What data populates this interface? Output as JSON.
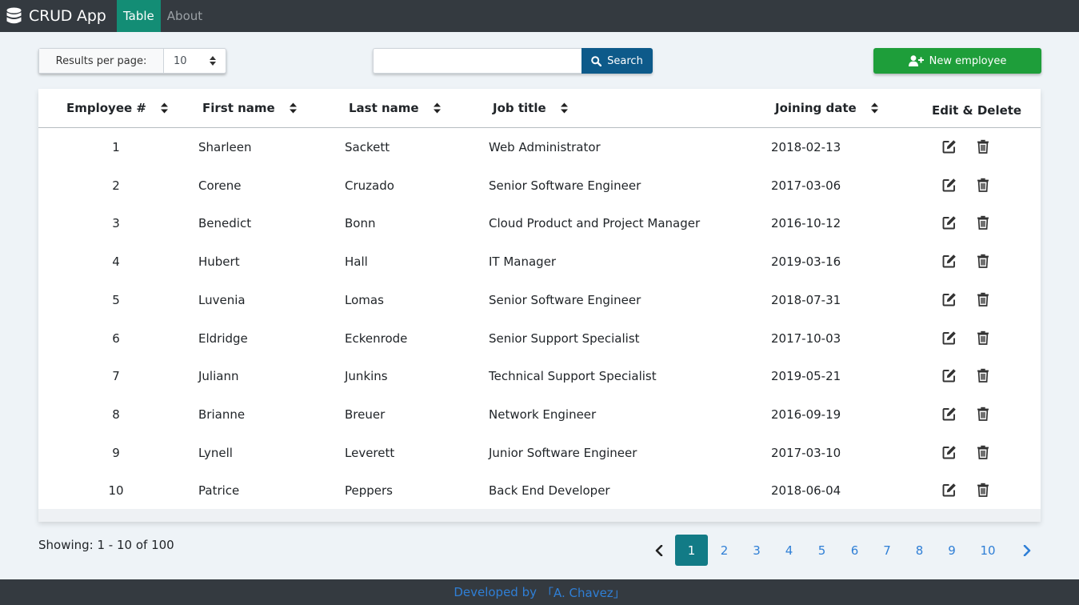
{
  "navbar": {
    "brand": "CRUD App",
    "tabs": [
      {
        "label": "Table",
        "active": true
      },
      {
        "label": "About",
        "active": false
      }
    ]
  },
  "toolbar": {
    "per_page_label": "Results per page:",
    "per_page_value": "10",
    "search_placeholder": "",
    "search_value": "",
    "search_label": "Search",
    "new_employee_label": "New employee"
  },
  "table": {
    "headers": [
      "Employee #",
      "First name",
      "Last name",
      "Job title",
      "Joining date",
      "Edit & Delete"
    ],
    "rows": [
      {
        "id": "1",
        "first": "Sharleen",
        "last": "Sackett",
        "job": "Web Administrator",
        "date": "2018-02-13"
      },
      {
        "id": "2",
        "first": "Corene",
        "last": "Cruzado",
        "job": "Senior Software Engineer",
        "date": "2017-03-06"
      },
      {
        "id": "3",
        "first": "Benedict",
        "last": "Bonn",
        "job": "Cloud Product and Project Manager",
        "date": "2016-10-12"
      },
      {
        "id": "4",
        "first": "Hubert",
        "last": "Hall",
        "job": "IT Manager",
        "date": "2019-03-16"
      },
      {
        "id": "5",
        "first": "Luvenia",
        "last": "Lomas",
        "job": "Senior Software Engineer",
        "date": "2018-07-31"
      },
      {
        "id": "6",
        "first": "Eldridge",
        "last": "Eckenrode",
        "job": "Senior Support Specialist",
        "date": "2017-10-03"
      },
      {
        "id": "7",
        "first": "Juliann",
        "last": "Junkins",
        "job": "Technical Support Specialist",
        "date": "2019-05-21"
      },
      {
        "id": "8",
        "first": "Brianne",
        "last": "Breuer",
        "job": "Network Engineer",
        "date": "2016-09-19"
      },
      {
        "id": "9",
        "first": "Lynell",
        "last": "Leverett",
        "job": "Junior Software Engineer",
        "date": "2017-03-10"
      },
      {
        "id": "10",
        "first": "Patrice",
        "last": "Peppers",
        "job": "Back End Developer",
        "date": "2018-06-04"
      }
    ]
  },
  "pagination": {
    "showing": "Showing: 1 - 10 of 100",
    "pages": [
      "1",
      "2",
      "3",
      "4",
      "5",
      "6",
      "7",
      "8",
      "9",
      "10"
    ],
    "current": "1"
  },
  "footer": {
    "prefix": "Developed by",
    "author": "「A. Chavez」"
  },
  "icons": {
    "brand": "database-icon",
    "sort": "sort-icon",
    "search": "search-icon",
    "new": "user-plus-icon",
    "edit": "edit-icon",
    "delete": "trash-icon",
    "prev": "chevron-left-icon",
    "next": "chevron-right-icon"
  },
  "colors": {
    "navbar_bg": "#343a40",
    "active_tab": "#138d75",
    "search_button": "#0d5a8a",
    "new_button": "#1e9e3a",
    "active_page": "#127b86",
    "link": "#2f7fd6"
  }
}
